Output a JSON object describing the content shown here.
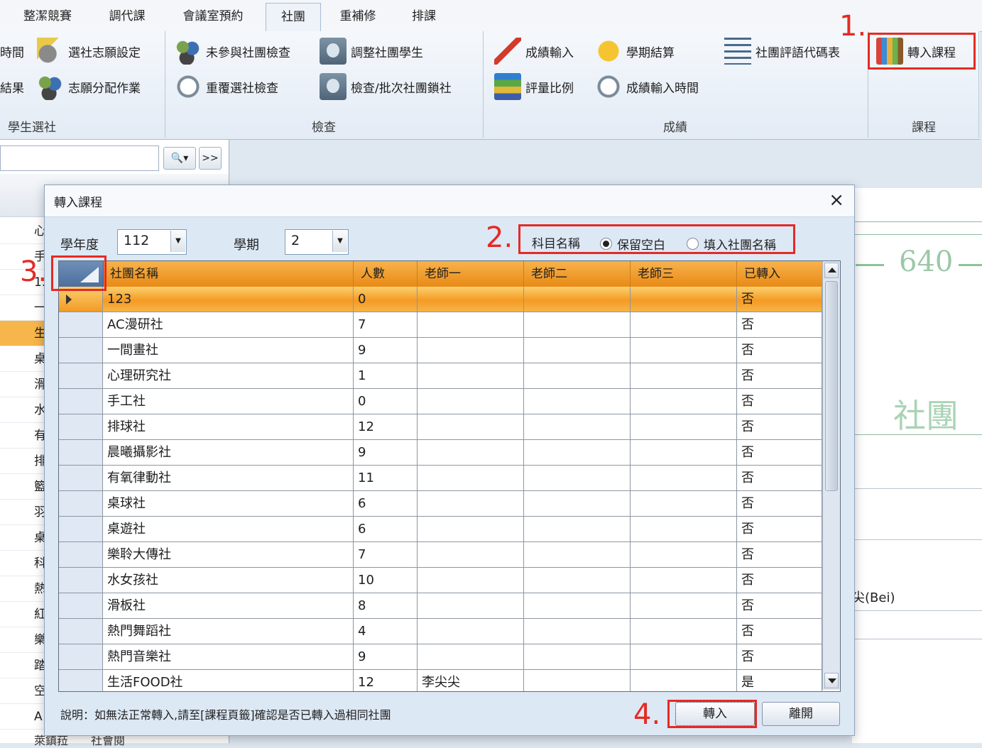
{
  "ribbon_tabs": [
    "整潔競賽",
    "調代課",
    "會議室預約",
    "社團",
    "重補修",
    "排課"
  ],
  "active_tab": "社團",
  "ribbon": {
    "student_selection": {
      "label": "學生選社",
      "buttons": [
        "時間",
        "選社志願設定",
        "結果",
        "志願分配作業"
      ]
    },
    "check": {
      "label": "檢查",
      "buttons": [
        "未參與社團檢查",
        "調整社團學生",
        "重覆選社檢查",
        "檢查/批次社團鎖社"
      ]
    },
    "grades": {
      "label": "成績",
      "buttons": [
        "成績輸入",
        "學期結算",
        "社團評語代碼表",
        "評量比例",
        "成績輸入時間"
      ]
    },
    "course": {
      "label": "課程",
      "buttons": [
        "轉入課程"
      ]
    }
  },
  "search": {
    "icon": "search-icon",
    "next_label": ">>"
  },
  "left_list_fragments": [
    "心",
    "手",
    "1.",
    "一",
    "生",
    "桌",
    "滑",
    "水",
    "有",
    "排",
    "籃",
    "羽",
    "桌",
    "科",
    "熱",
    "紅",
    "樂",
    "踏",
    "空",
    "A"
  ],
  "background_right": {
    "number": "640",
    "club": "社團",
    "name_fragment": "尖(Bei)"
  },
  "background_bottom": "萊鎮菈　　社會閱",
  "dialog": {
    "title": "轉入課程",
    "close_label": "×",
    "school_year_label": "學年度",
    "school_year_value": "112",
    "semester_label": "學期",
    "semester_value": "2",
    "subject_name_label": "科目名稱",
    "radio_options": [
      {
        "label": "保留空白",
        "selected": true
      },
      {
        "label": "填入社團名稱",
        "selected": false
      }
    ],
    "columns": [
      "社團名稱",
      "人數",
      "老師一",
      "老師二",
      "老師三",
      "已轉入"
    ],
    "rows": [
      [
        "123",
        "0",
        "",
        "",
        "",
        "否"
      ],
      [
        "AC漫研社",
        "7",
        "",
        "",
        "",
        "否"
      ],
      [
        "一間畫社",
        "9",
        "",
        "",
        "",
        "否"
      ],
      [
        "心理研究社",
        "1",
        "",
        "",
        "",
        "否"
      ],
      [
        "手工社",
        "0",
        "",
        "",
        "",
        "否"
      ],
      [
        "排球社",
        "12",
        "",
        "",
        "",
        "否"
      ],
      [
        "晨曦攝影社",
        "9",
        "",
        "",
        "",
        "否"
      ],
      [
        "有氧律動社",
        "11",
        "",
        "",
        "",
        "否"
      ],
      [
        "桌球社",
        "6",
        "",
        "",
        "",
        "否"
      ],
      [
        "桌遊社",
        "6",
        "",
        "",
        "",
        "否"
      ],
      [
        "樂聆大傳社",
        "7",
        "",
        "",
        "",
        "否"
      ],
      [
        "水女孩社",
        "10",
        "",
        "",
        "",
        "否"
      ],
      [
        "滑板社",
        "8",
        "",
        "",
        "",
        "否"
      ],
      [
        "熱門舞蹈社",
        "4",
        "",
        "",
        "",
        "否"
      ],
      [
        "熱門音樂社",
        "9",
        "",
        "",
        "",
        "否"
      ],
      [
        "生活FOOD社",
        "12",
        "李尖尖",
        "",
        "",
        "是"
      ]
    ],
    "selected_row": 0,
    "note": "說明：如無法正常轉入,請至[課程頁籤]確認是否已轉入過相同社團",
    "transfer_button": "轉入",
    "leave_button": "離開"
  },
  "annotations": [
    "1.",
    "2.",
    "3.",
    "4."
  ],
  "accent_colors": {
    "highlight": "#e52a24",
    "header_orange": "#f0981f"
  }
}
